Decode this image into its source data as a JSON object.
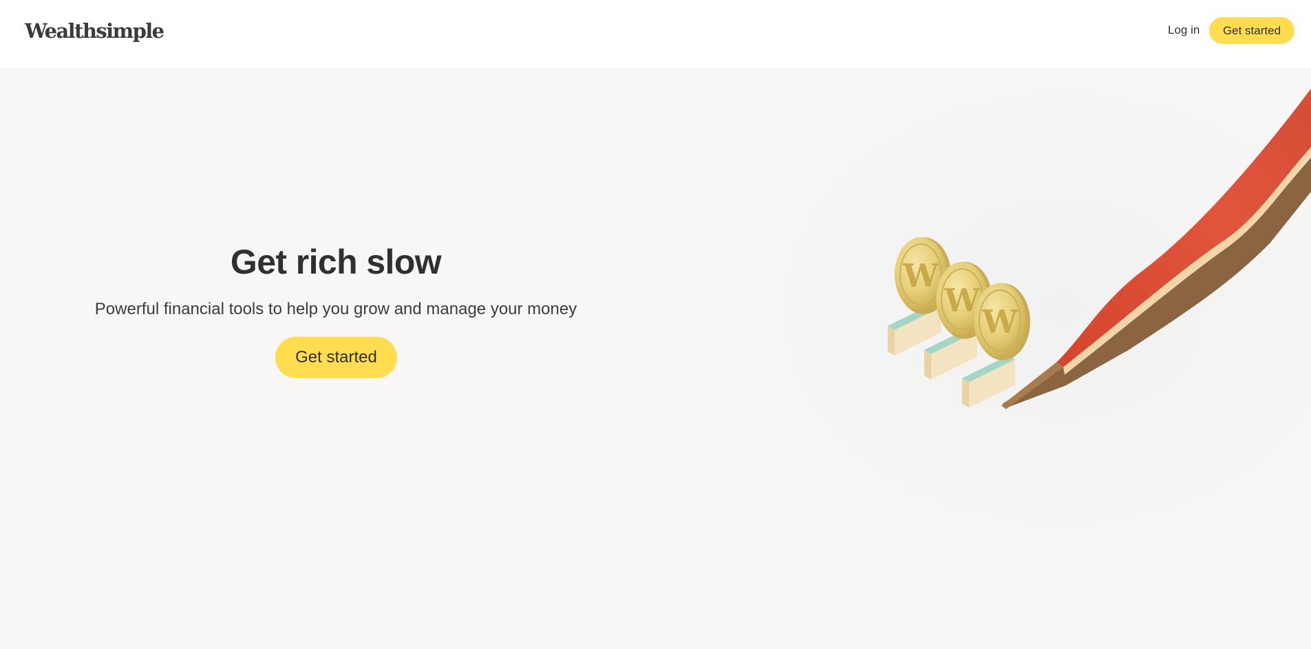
{
  "header": {
    "logo": "Wealthsimple",
    "login_label": "Log in",
    "cta_label": "Get started"
  },
  "hero": {
    "title": "Get rich slow",
    "subtitle": "Powerful financial tools to help you grow and manage your money",
    "cta_label": "Get started"
  },
  "illustration": {
    "coin_glyph": "W",
    "colors": {
      "ribbon": "#dd4f37",
      "coin": "#e6cf78",
      "stand_top": "#9fd2c5",
      "stand_base": "#f1dfb9",
      "accent": "#ffdd4f"
    }
  }
}
